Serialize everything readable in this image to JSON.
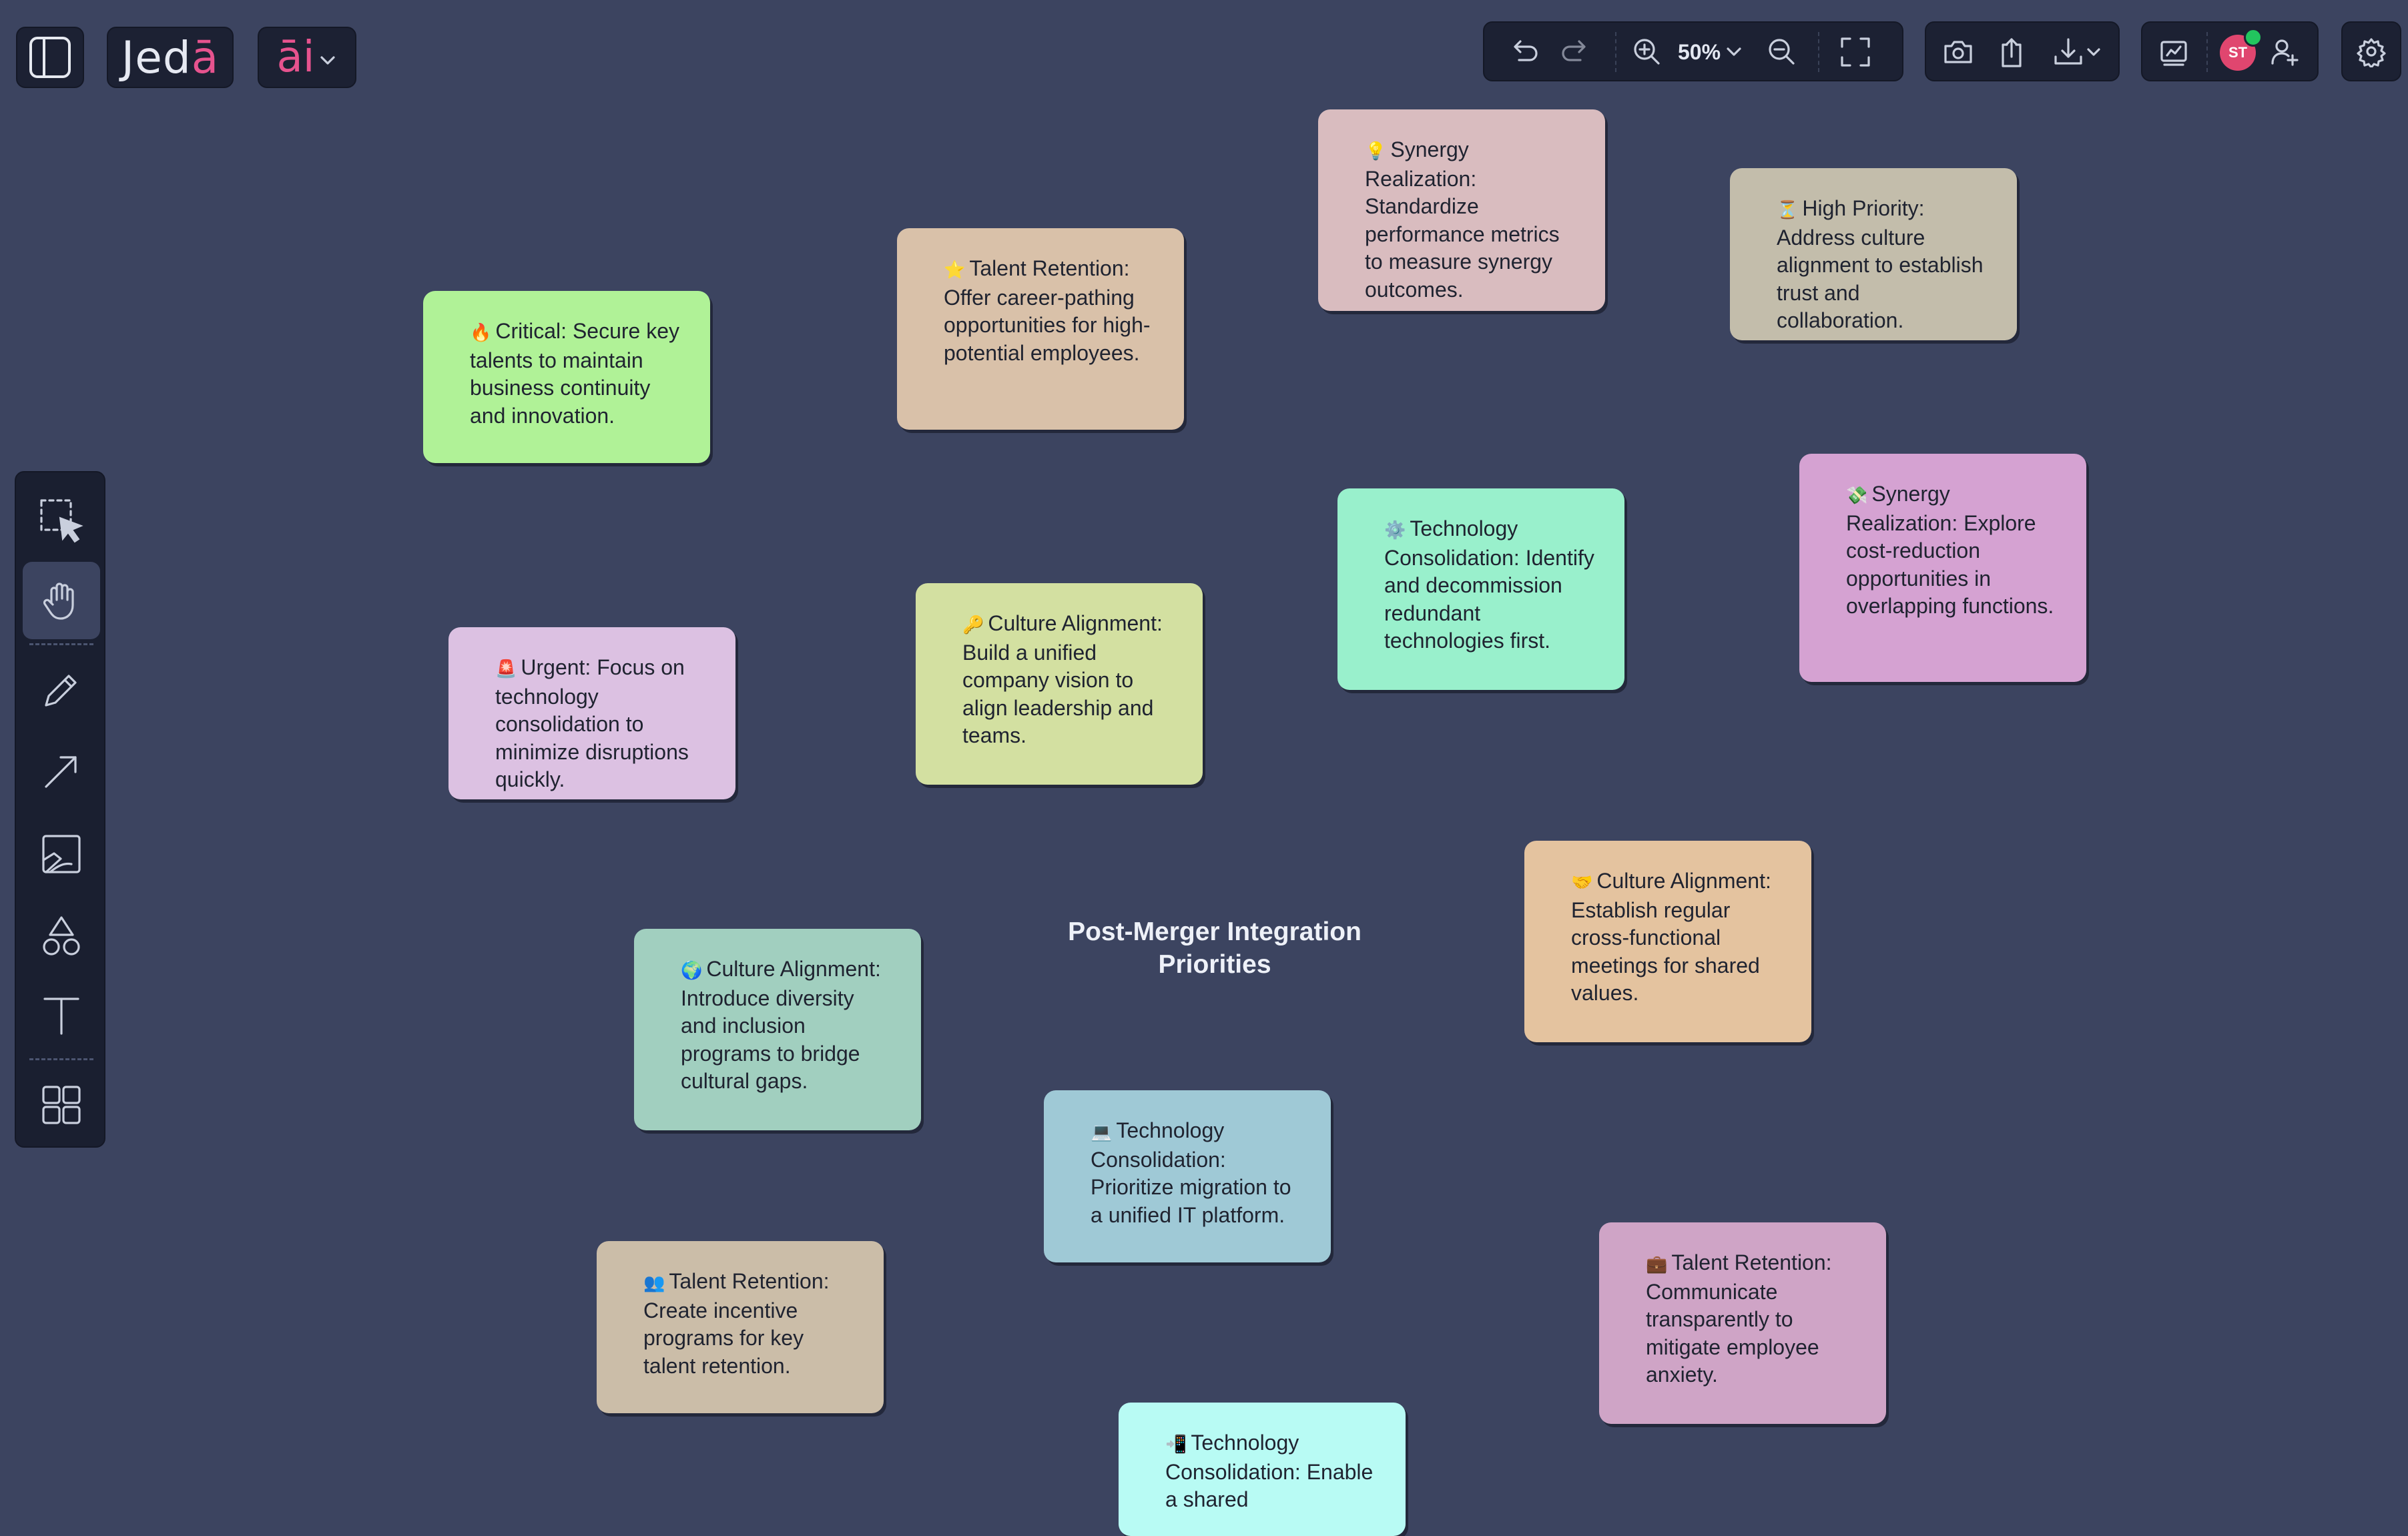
{
  "header": {
    "logo_prefix": "Jed",
    "logo_accent": "ā",
    "ai_logo": "āi",
    "zoom_level": "50%"
  },
  "user": {
    "initials": "ST",
    "avatar_color": "#e0466f",
    "online": true
  },
  "toolbar_icons": [
    "sidebar-toggle-icon",
    "undo-icon",
    "redo-icon",
    "zoom-in-icon",
    "zoom-out-icon",
    "fit-screen-icon",
    "camera-icon",
    "upload-icon",
    "download-icon",
    "present-icon",
    "add-user-icon",
    "gear-icon"
  ],
  "left_tools": [
    "select-tool",
    "hand-tool",
    "pen-tool",
    "arrow-tool",
    "image-tool",
    "shapes-tool",
    "text-tool",
    "templates-tool"
  ],
  "active_tool": "hand-tool",
  "canvas": {
    "title": "Post-Merger Integration Priorities",
    "notes": [
      {
        "emoji": "💡",
        "text": "Synergy Realization: Standardize performance metrics to measure synergy outcomes.",
        "color": "#d9bcbf"
      },
      {
        "emoji": "⏳",
        "text": "High Priority: Address culture alignment to establish trust and collaboration.",
        "color": "#c3bdab"
      },
      {
        "emoji": "⭐",
        "text": "Talent Retention: Offer career-pathing opportunities for high-potential employees.",
        "color": "#d9c1a9"
      },
      {
        "emoji": "🔥",
        "text": "Critical: Secure key talents to maintain business continuity and innovation.",
        "color": "#b0f297"
      },
      {
        "emoji": "⚙️",
        "text": "Technology Consolidation: Identify and decommission redundant technologies first.",
        "color": "#99f0cc"
      },
      {
        "emoji": "💸",
        "text": "Synergy Realization: Explore cost-reduction opportunities in overlapping functions.",
        "color": "#d5a2d2"
      },
      {
        "emoji": "🔑",
        "text": "Culture Alignment: Build a unified company vision to align leadership and teams.",
        "color": "#d3e0a1"
      },
      {
        "emoji": "🚨",
        "text": "Urgent: Focus on technology consolidation to minimize disruptions quickly.",
        "color": "#dcc1e2"
      },
      {
        "emoji": "🤝",
        "text": "Culture Alignment: Establish regular cross-functional meetings for shared values.",
        "color": "#e4c39f"
      },
      {
        "emoji": "🌍",
        "text": "Culture Alignment: Introduce diversity and inclusion programs to bridge cultural gaps.",
        "color": "#a1cfbf"
      },
      {
        "emoji": "💻",
        "text": "Technology Consolidation: Prioritize migration to a unified IT platform.",
        "color": "#9fc9d6"
      },
      {
        "emoji": "👥",
        "text": "Talent Retention: Create incentive programs for key talent retention.",
        "color": "#cbbda8"
      },
      {
        "emoji": "💼",
        "text": "Talent Retention: Communicate transparently to mitigate employee anxiety.",
        "color": "#cfa4c6"
      },
      {
        "emoji": "📲",
        "text": "Technology Consolidation: Enable a shared",
        "color": "#b8fbf4"
      }
    ]
  }
}
